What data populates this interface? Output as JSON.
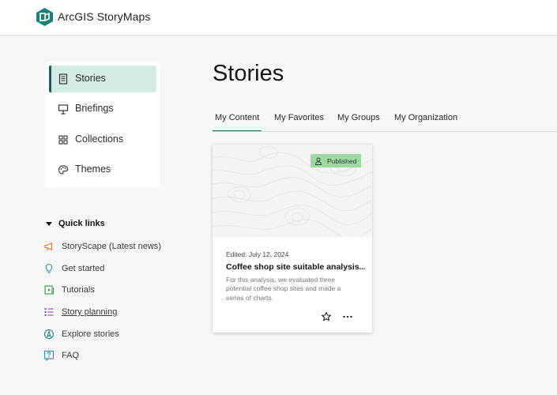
{
  "app": {
    "brand": "ArcGIS StoryMaps",
    "accent": "#1d6b5f",
    "logo_icon": "storymaps-logo-icon"
  },
  "sidebar": {
    "items": [
      {
        "label": "Stories",
        "icon": "document-icon",
        "active": true
      },
      {
        "label": "Briefings",
        "icon": "presentation-icon",
        "active": false
      },
      {
        "label": "Collections",
        "icon": "grid-icon",
        "active": false
      },
      {
        "label": "Themes",
        "icon": "palette-icon",
        "active": false
      }
    ]
  },
  "quick_links": {
    "heading": "Quick links",
    "items": [
      {
        "label": "StoryScape (Latest news)",
        "icon": "megaphone-icon"
      },
      {
        "label": "Get started",
        "icon": "lightbulb-icon"
      },
      {
        "label": "Tutorials",
        "icon": "tutorial-icon"
      },
      {
        "label": "Story planning",
        "icon": "checklist-icon"
      },
      {
        "label": "Explore stories",
        "icon": "compass-icon"
      },
      {
        "label": "FAQ",
        "icon": "question-book-icon"
      }
    ]
  },
  "main": {
    "title": "Stories",
    "tabs": [
      {
        "label": "My Content",
        "active": true
      },
      {
        "label": "My Favorites",
        "active": false
      },
      {
        "label": "My Groups",
        "active": false
      },
      {
        "label": "My Organization",
        "active": false
      }
    ],
    "cards": [
      {
        "status": "Published",
        "edited": "Edited: July 12, 2024",
        "title": "Coffee shop site suitable analysis...",
        "description": "For this analysis, we evaluated three potential coffee shop sites and made a series of charts.",
        "badge_color": "#9ed9a5"
      }
    ]
  }
}
